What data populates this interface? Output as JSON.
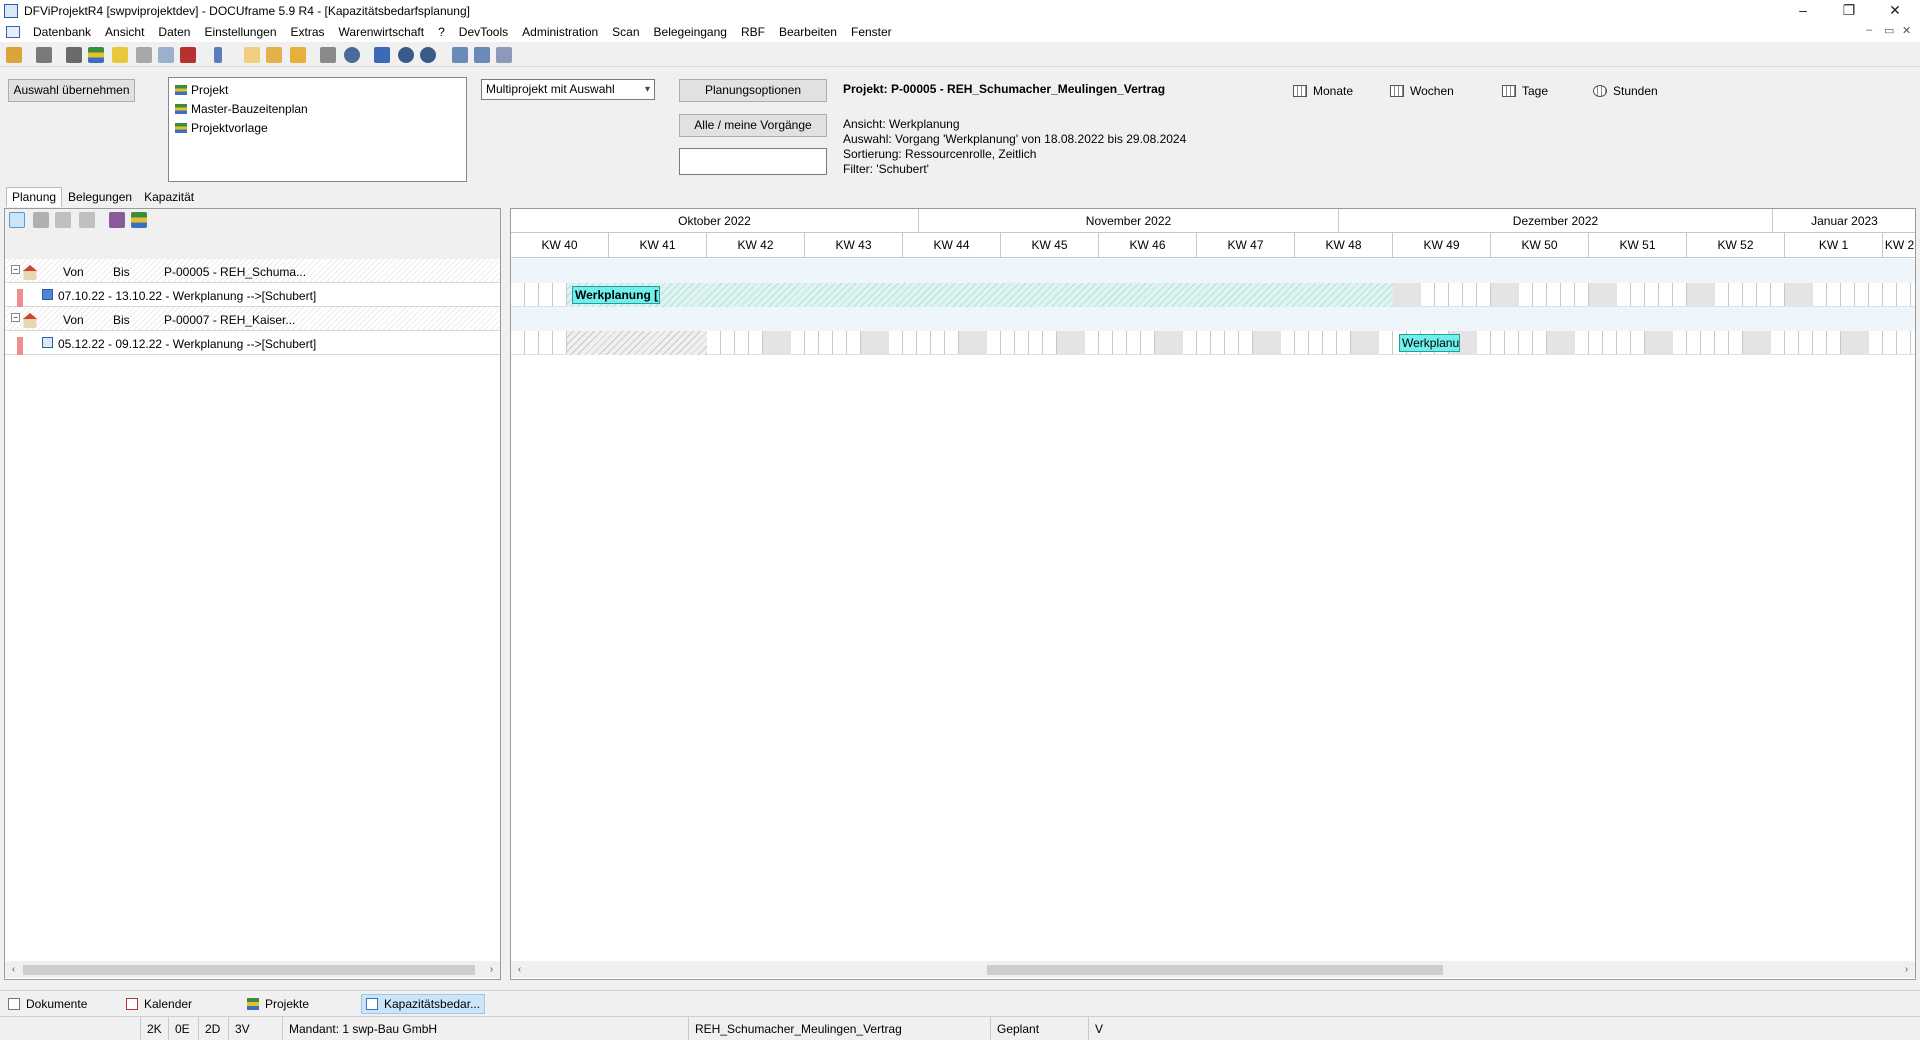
{
  "window": {
    "title": "DFViProjektR4 [swpviprojektdev] - DOCUframe 5.9 R4 - [Kapazitätsbedarfsplanung]",
    "minimize": "–",
    "restore": "❐",
    "close": "✕"
  },
  "menu": [
    "Datenbank",
    "Ansicht",
    "Daten",
    "Einstellungen",
    "Extras",
    "Warenwirtschaft",
    "?",
    "DevTools",
    "Administration",
    "Scan",
    "Belegeingang",
    "RBF",
    "Bearbeiten",
    "Fenster"
  ],
  "mdi_controls": {
    "minimize": "–",
    "restore": "▭",
    "close": "✕"
  },
  "toolbar_icons": [
    "open-icon",
    "print-icon",
    "card-icon",
    "list-icon",
    "note-icon",
    "attach-icon",
    "copy-icon",
    "calendar-icon",
    "phone-icon",
    "new-doc-icon",
    "folder-icon",
    "export-icon",
    "grid-icon",
    "search-icon",
    "fullscreen-icon",
    "zoom-in-icon",
    "zoom-out-icon",
    "prev-icon",
    "next-icon",
    "table-icon"
  ],
  "top": {
    "apply_button": "Auswahl übernehmen",
    "type_list": [
      "Projekt",
      "Master-Bauzeitenplan",
      "Projektvorlage"
    ],
    "mode_combo": "Multiprojekt mit Auswahl",
    "planning_options_button": "Planungsoptionen",
    "all_mine_button": "Alle / meine Vorgänge",
    "search_value": "",
    "project_title": "Projekt: P-00005 - REH_Schumacher_Meulingen_Vertrag",
    "info_lines": [
      "Ansicht: Werkplanung",
      "Auswahl: Vorgang 'Werkplanung' von 18.08.2022 bis 29.08.2024",
      "Sortierung: Ressourcenrolle, Zeitlich",
      "Filter: 'Schubert'"
    ],
    "scales": [
      "Monate",
      "Wochen",
      "Tage",
      "Stunden"
    ]
  },
  "tabs": [
    "Planung",
    "Belegungen",
    "Kapazität"
  ],
  "tree": [
    {
      "von": "Von",
      "bis": "Bis",
      "project": "P-00005 - REH_Schuma...",
      "task": "07.10.22 - 13.10.22 - Werkplanung   -->[Schubert]"
    },
    {
      "von": "Von",
      "bis": "Bis",
      "project": "P-00007 - REH_Kaiser...",
      "task": "05.12.22 - 09.12.22 - Werkplanung   -->[Schubert]"
    }
  ],
  "gantt": {
    "months": [
      "Oktober 2022",
      "November 2022",
      "Dezember 2022",
      "Januar 2023"
    ],
    "weeks": [
      "KW 40",
      "KW 41",
      "KW 42",
      "KW 43",
      "KW 44",
      "KW 45",
      "KW 46",
      "KW 47",
      "KW 48",
      "KW 49",
      "KW 50",
      "KW 51",
      "KW 52",
      "KW 1",
      "KW 2"
    ],
    "bars": [
      {
        "label": "Werkplanung [",
        "start": "07.10.22",
        "end": "13.10.22"
      },
      {
        "label": "Werkplanu",
        "start": "05.12.22",
        "end": "09.12.22"
      }
    ]
  },
  "taskbar": [
    "Dokumente",
    "Kalender",
    "Projekte",
    "Kapazitätsbedar..."
  ],
  "status": {
    "c1": "2K",
    "c2": "0E",
    "c3": "2D",
    "c4": "3V",
    "mandant": "Mandant: 1 swp-Bau GmbH",
    "project": "REH_Schumacher_Meulingen_Vertrag",
    "state": "Geplant",
    "flag": "V"
  }
}
